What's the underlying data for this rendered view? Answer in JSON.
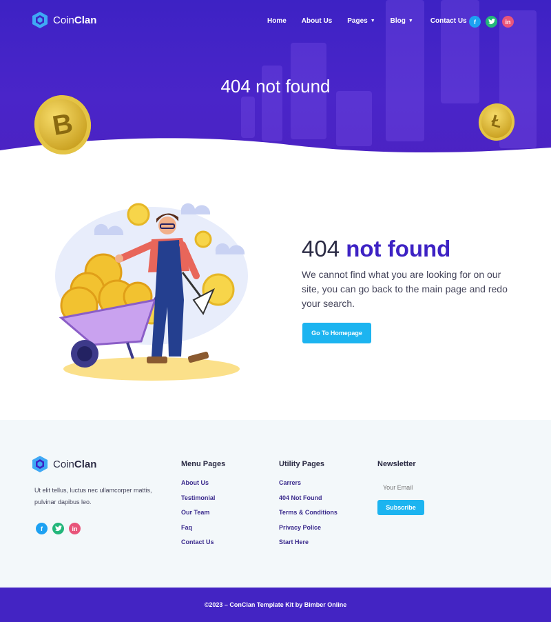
{
  "brand": {
    "name_light": "Coin",
    "name_bold": "Clan",
    "accent": "#3d22c4",
    "button_color": "#1cb4f0"
  },
  "nav": {
    "items": [
      {
        "label": "Home",
        "caret": false
      },
      {
        "label": "About Us",
        "caret": false
      },
      {
        "label": "Pages",
        "caret": true
      },
      {
        "label": "Blog",
        "caret": true
      },
      {
        "label": "Contact Us",
        "caret": false
      }
    ],
    "social": [
      "facebook-icon",
      "twitter-icon",
      "linkedin-icon"
    ]
  },
  "hero": {
    "title": "404 not found"
  },
  "main": {
    "title_light": "404 ",
    "title_bold": "not found",
    "text": "We cannot find what you are looking for on our site, you can go back to the main page and redo your search.",
    "button": "Go To Homepage"
  },
  "footer": {
    "about": "Ut elit tellus, luctus nec ullamcorper mattis, pulvinar dapibus leo.",
    "menu": {
      "title": "Menu Pages",
      "items": [
        "About Us",
        "Testimonial",
        "Our Team",
        "Faq",
        "Contact Us"
      ]
    },
    "utility": {
      "title": "Utility Pages",
      "items": [
        "Carrers",
        "404 Not Found",
        "Terms & Conditions",
        "Privacy Police",
        "Start Here"
      ]
    },
    "newsletter": {
      "title": "Newsletter",
      "placeholder": "Your Email",
      "button": "Subscribe"
    },
    "copyright": "©2023 – ConClan Template Kit by Bimber Online"
  }
}
